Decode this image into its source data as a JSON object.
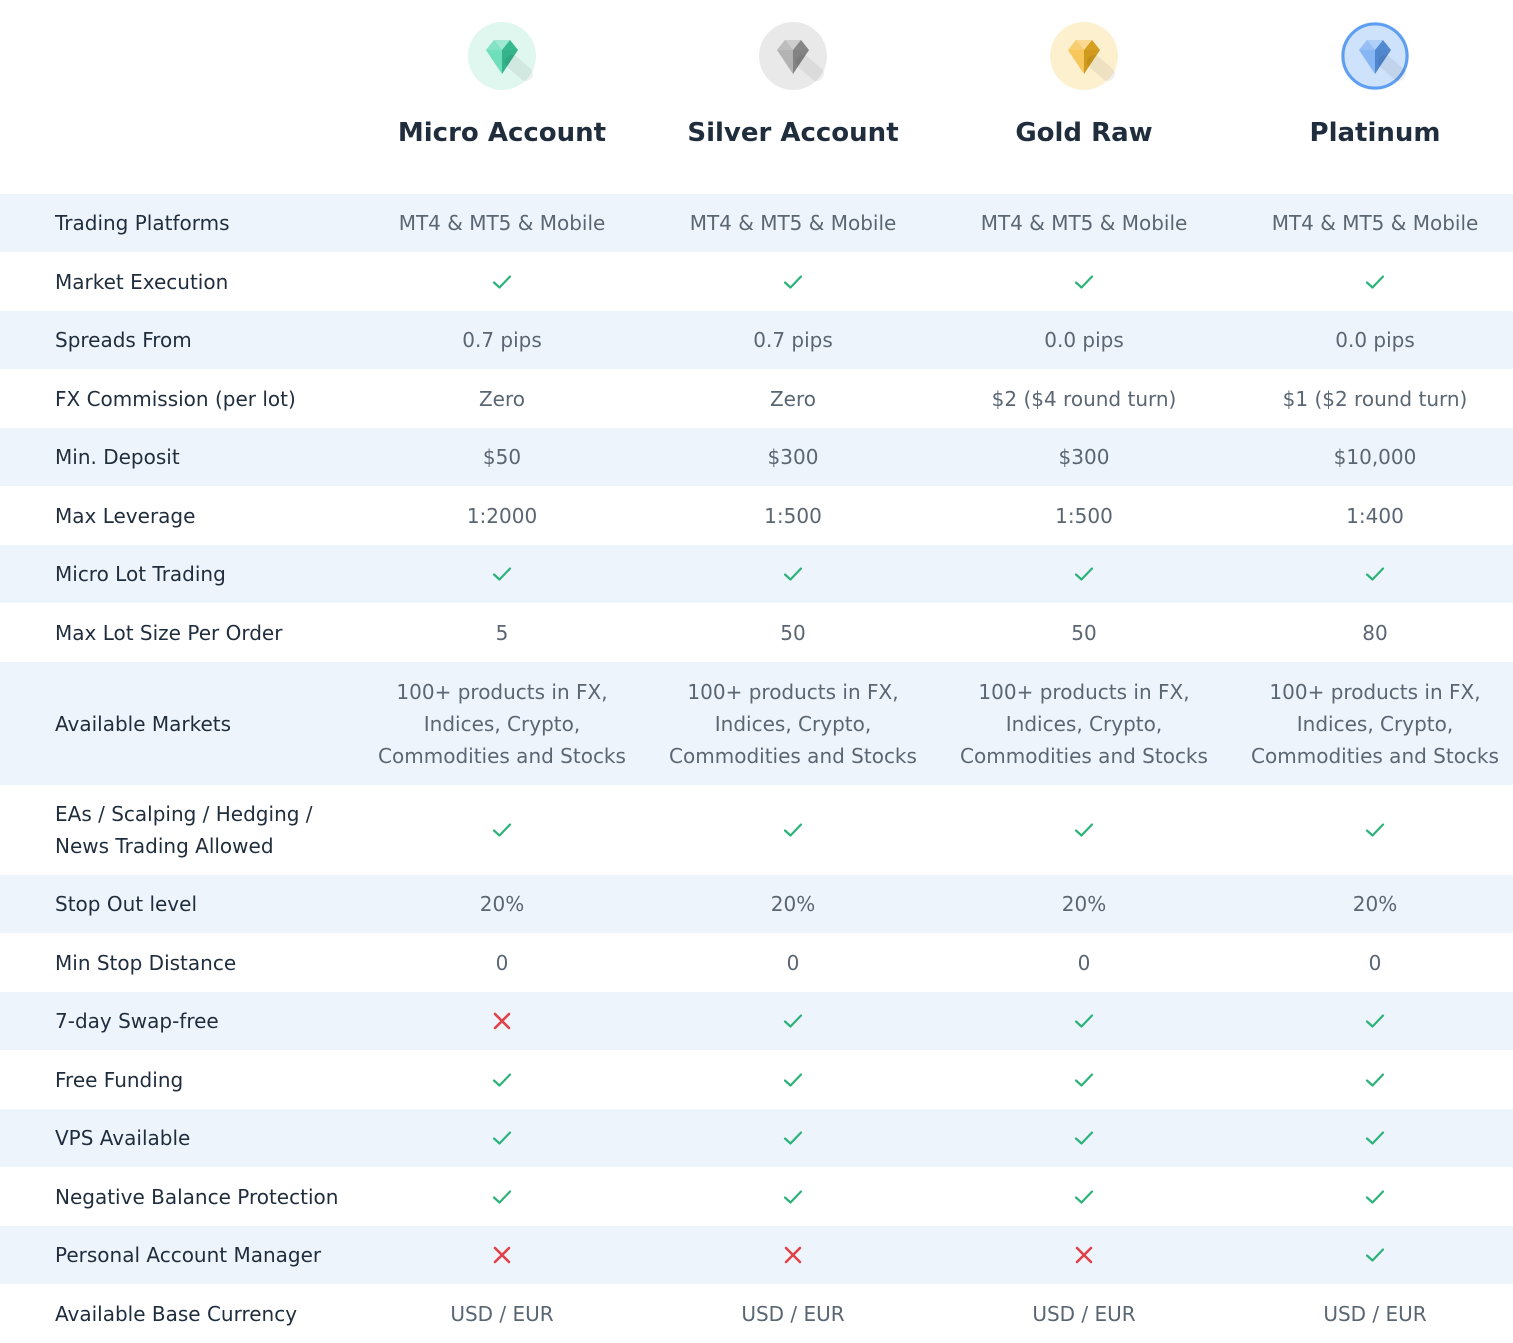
{
  "plans": [
    {
      "name": "Micro Account",
      "icon": "diamond-green-icon",
      "color": "#3fd3a3",
      "bg": "#dff7ee"
    },
    {
      "name": "Silver Account",
      "icon": "diamond-silver-icon",
      "color": "#9a9a9a",
      "bg": "#e9e9e9"
    },
    {
      "name": "Gold Raw",
      "icon": "diamond-gold-icon",
      "color": "#f5b524",
      "bg": "#fdf0cf"
    },
    {
      "name": "Platinum",
      "icon": "diamond-blue-icon",
      "color": "#5e9ef0",
      "bg": "#cfe2fb"
    }
  ],
  "colors": {
    "check": "#2db37a",
    "cross": "#e0424a",
    "alt_row": "#eef4fc",
    "label": "#1f2d3d",
    "value": "#5b6673"
  },
  "rows": [
    {
      "label": "Trading Platforms",
      "values": [
        "MT4 & MT5 & Mobile",
        "MT4 & MT5 & Mobile",
        "MT4 & MT5 & Mobile",
        "MT4 & MT5 & Mobile"
      ]
    },
    {
      "label": "Market Execution",
      "values": [
        "check",
        "check",
        "check",
        "check"
      ]
    },
    {
      "label": "Spreads From",
      "values": [
        "0.7 pips",
        "0.7 pips",
        "0.0 pips",
        "0.0 pips"
      ]
    },
    {
      "label": "FX Commission (per lot)",
      "values": [
        "Zero",
        "Zero",
        "$2 ($4 round turn)",
        "$1 ($2 round turn)"
      ]
    },
    {
      "label": "Min. Deposit",
      "values": [
        "$50",
        "$300",
        "$300",
        "$10,000"
      ]
    },
    {
      "label": "Max Leverage",
      "values": [
        "1:2000",
        "1:500",
        "1:500",
        "1:400"
      ]
    },
    {
      "label": "Micro Lot Trading",
      "values": [
        "check",
        "check",
        "check",
        "check"
      ]
    },
    {
      "label": "Max Lot Size Per Order",
      "values": [
        "5",
        "50",
        "50",
        "80"
      ]
    },
    {
      "label": "Available Markets",
      "values": [
        "100+ products in FX, Indices, Crypto, Commodities and Stocks",
        "100+ products in FX, Indices, Crypto, Commodities and Stocks",
        "100+ products in FX, Indices, Crypto, Commodities and Stocks",
        "100+ products in FX, Indices, Crypto, Commodities and Stocks"
      ]
    },
    {
      "label": "EAs / Scalping / Hedging / News Trading Allowed",
      "values": [
        "check",
        "check",
        "check",
        "check"
      ]
    },
    {
      "label": "Stop Out level",
      "values": [
        "20%",
        "20%",
        "20%",
        "20%"
      ]
    },
    {
      "label": "Min Stop Distance",
      "values": [
        "0",
        "0",
        "0",
        "0"
      ]
    },
    {
      "label": "7-day Swap-free",
      "values": [
        "cross",
        "check",
        "check",
        "check"
      ]
    },
    {
      "label": "Free Funding",
      "values": [
        "check",
        "check",
        "check",
        "check"
      ]
    },
    {
      "label": "VPS Available",
      "values": [
        "check",
        "check",
        "check",
        "check"
      ]
    },
    {
      "label": "Negative Balance Protection",
      "values": [
        "check",
        "check",
        "check",
        "check"
      ]
    },
    {
      "label": "Personal Account Manager",
      "values": [
        "cross",
        "cross",
        "cross",
        "check"
      ]
    },
    {
      "label": "Available Base Currency",
      "values": [
        "USD / EUR",
        "USD / EUR",
        "USD / EUR",
        "USD / EUR"
      ]
    }
  ]
}
